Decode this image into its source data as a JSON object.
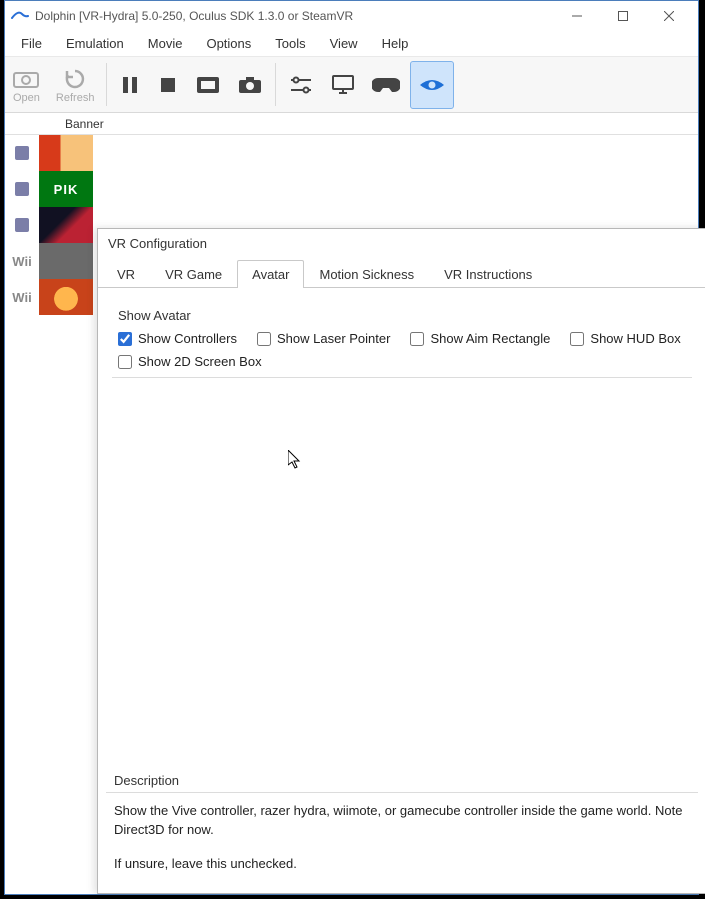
{
  "window": {
    "title": "Dolphin [VR-Hydra] 5.0-250, Oculus SDK 1.3.0 or SteamVR"
  },
  "menubar": [
    "File",
    "Emulation",
    "Movie",
    "Options",
    "Tools",
    "View",
    "Help"
  ],
  "toolbar": {
    "open": "Open",
    "refresh": "Refresh"
  },
  "list": {
    "header": "Banner",
    "platforms": {
      "gc": "GC",
      "wii": "Wii"
    },
    "pik_text": "PIK"
  },
  "dialog": {
    "title": "VR Configuration",
    "tabs": [
      "VR",
      "VR Game",
      "Avatar",
      "Motion Sickness",
      "VR Instructions"
    ],
    "selected_tab": "Avatar",
    "group_label": "Show Avatar",
    "checkboxes": {
      "show_controllers": "Show Controllers",
      "show_laser_pointer": "Show Laser Pointer",
      "show_aim_rectangle": "Show Aim Rectangle",
      "show_hud_box": "Show HUD Box",
      "show_2d_screen_box": "Show 2D Screen Box"
    },
    "checked": {
      "show_controllers": true
    },
    "description": {
      "label": "Description",
      "line1": "Show the Vive controller, razer hydra, wiimote, or gamecube controller inside the game world. Note Direct3D for now.",
      "line2": "If unsure, leave this unchecked."
    }
  }
}
